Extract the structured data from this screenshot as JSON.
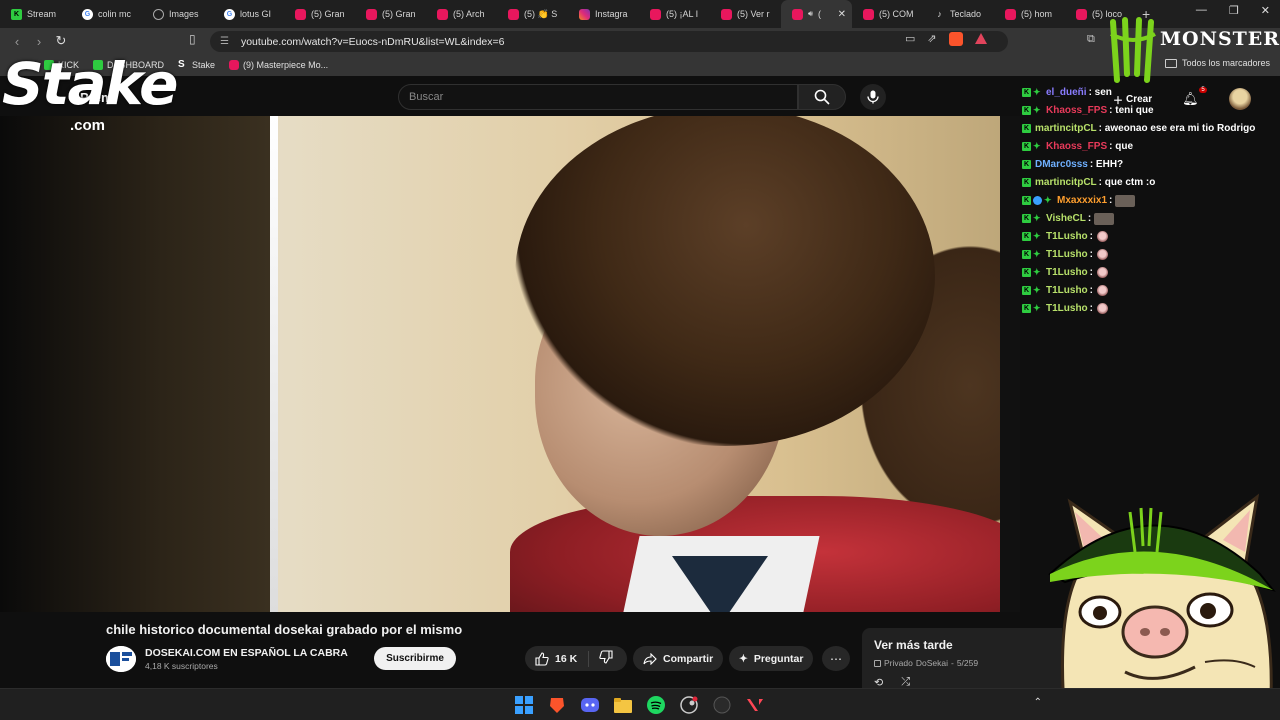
{
  "browser": {
    "tabs": [
      {
        "title": "Stream",
        "icon": "kick-icon",
        "active": false
      },
      {
        "title": "colin mc",
        "icon": "google-icon",
        "active": false
      },
      {
        "title": "Images",
        "icon": "globe-icon",
        "active": false
      },
      {
        "title": "lotus GI",
        "icon": "google-icon",
        "active": false
      },
      {
        "title": "(5) Gran",
        "icon": "youtube-icon",
        "active": false
      },
      {
        "title": "(5) Gran",
        "icon": "youtube-icon",
        "active": false
      },
      {
        "title": "(5) Arch",
        "icon": "youtube-icon",
        "active": false
      },
      {
        "title": "(5) 👏 S",
        "icon": "youtube-icon",
        "active": false
      },
      {
        "title": "Instagra",
        "icon": "instagram-icon",
        "active": false
      },
      {
        "title": "(5) ¡AL I",
        "icon": "youtube-icon",
        "active": false
      },
      {
        "title": "(5) Ver r",
        "icon": "youtube-icon",
        "active": false
      },
      {
        "title": "(",
        "icon": "youtube-icon",
        "active": true
      },
      {
        "title": "(5) COM",
        "icon": "youtube-icon",
        "active": false
      },
      {
        "title": "Teclado",
        "icon": "tiktok-icon",
        "active": false
      },
      {
        "title": "(5) hom",
        "icon": "youtube-icon",
        "active": false
      },
      {
        "title": "(5) loco",
        "icon": "youtube-icon",
        "active": false
      }
    ],
    "url": "youtube.com/watch?v=Euocs-nDmRU&list=WL&index=6",
    "bookmarks": [
      {
        "label": "KICK",
        "icon": "kick-icon"
      },
      {
        "label": "DASHBOARD",
        "icon": "kick-icon"
      },
      {
        "label": "Stake",
        "icon": "stake-icon"
      },
      {
        "label": "(9) Masterpiece Mo...",
        "icon": "youtube-icon"
      }
    ],
    "all_bookmarks": "Todos los marcadores"
  },
  "youtube": {
    "search_placeholder": "Buscar",
    "header_partial": "Premi",
    "create_label": "Crear",
    "notifications_count": "5",
    "video_title": "chile historico documental dosekai grabado por el mismo",
    "channel_name": "DOSEKAI.COM EN ESPAÑOL LA CABRA",
    "subscribers": "4,18 K suscriptores",
    "subscribe_label": "Suscribirme",
    "likes": "16 K",
    "share_label": "Compartir",
    "ask_label": "Preguntar",
    "playlist": {
      "title": "Ver más tarde",
      "privacy": "Privado",
      "owner": "DoSekai",
      "position": "5/259"
    }
  },
  "overlay": {
    "stake_word": "Stake",
    "stake_com": ".com",
    "monster_text": "MONSTER",
    "chat": [
      {
        "user": "el_dueñi",
        "text": ": sen",
        "color": "#8a7cff",
        "badges": [
          "k",
          "s"
        ]
      },
      {
        "user": "Khaoss_FPS",
        "text": ": teni que",
        "color": "#e83a5a",
        "badges": [
          "k",
          "s"
        ]
      },
      {
        "user": "martincitpCL",
        "text": ": aweonao ese era mi tio Rodrigo",
        "color": "#b7e06a",
        "badges": [
          "k"
        ]
      },
      {
        "user": "Khaoss_FPS",
        "text": ": que",
        "color": "#e83a5a",
        "badges": [
          "k",
          "s"
        ]
      },
      {
        "user": "DMarc0sss",
        "text": ": EHH?",
        "color": "#6fb0ff",
        "badges": [
          "k"
        ]
      },
      {
        "user": "martincitpCL",
        "text": ": que ctm :o",
        "color": "#b7e06a",
        "badges": [
          "k"
        ]
      },
      {
        "user": "Mxaxxxix1",
        "text": ":",
        "color": "#ff9f2e",
        "badges": [
          "k",
          "b",
          "s"
        ],
        "emote": true
      },
      {
        "user": "VisheCL",
        "text": ":",
        "color": "#b7e06a",
        "badges": [
          "k",
          "s"
        ],
        "emote": true
      },
      {
        "user": "T1Lusho",
        "text": ":",
        "color": "#b7e06a",
        "badges": [
          "k",
          "s"
        ],
        "face": true
      },
      {
        "user": "T1Lusho",
        "text": ":",
        "color": "#b7e06a",
        "badges": [
          "k",
          "s"
        ],
        "face": true
      },
      {
        "user": "T1Lusho",
        "text": ":",
        "color": "#b7e06a",
        "badges": [
          "k",
          "s"
        ],
        "face": true
      },
      {
        "user": "T1Lusho",
        "text": ":",
        "color": "#b7e06a",
        "badges": [
          "k",
          "s"
        ],
        "face": true
      },
      {
        "user": "T1Lusho",
        "text": ":",
        "color": "#b7e06a",
        "badges": [
          "k",
          "s"
        ],
        "face": true
      }
    ]
  },
  "taskbar": {
    "icons": [
      "windows-start-icon",
      "brave-icon",
      "discord-icon",
      "file-explorer-icon",
      "spotify-icon",
      "steam-icon",
      "obs-icon",
      "valorant-icon"
    ]
  }
}
